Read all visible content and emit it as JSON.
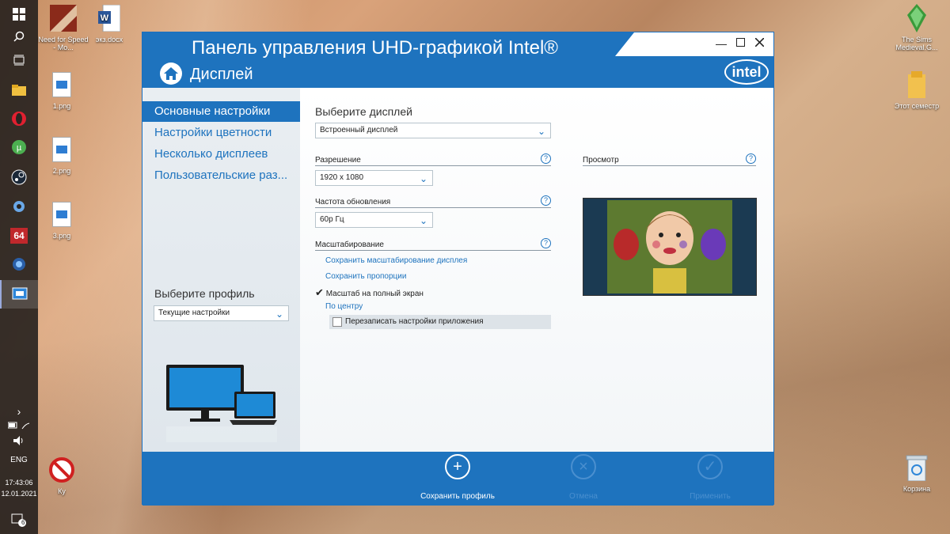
{
  "desktop": {
    "icons_left": [
      {
        "label": "Need for Speed - Mo...",
        "icon": "game-icon"
      },
      {
        "label": "экз.docx",
        "icon": "word-document-icon"
      },
      {
        "label": "1.png",
        "icon": "image-file-icon"
      },
      {
        "label": "2.png",
        "icon": "image-file-icon"
      },
      {
        "label": "3.png",
        "icon": "image-file-icon"
      },
      {
        "label": "Ку",
        "icon": "no-entry-icon"
      }
    ],
    "icons_right": [
      {
        "label": "The Sims Medieval.G...",
        "icon": "game-icon"
      },
      {
        "label": "Этот семестр",
        "icon": "folder-icon"
      },
      {
        "label": "Корзина",
        "icon": "recycle-bin-icon"
      }
    ]
  },
  "taskbar": {
    "language": "ENG",
    "time": "17:43:06",
    "date": "12.01.2021",
    "notification_count": "6",
    "app_badge": "64"
  },
  "window": {
    "title": "Панель управления UHD-графикой Intel®",
    "section": "Дисплей",
    "brand_logo": "intel",
    "sidebar": {
      "items": [
        {
          "label": "Основные настройки",
          "active": true
        },
        {
          "label": "Настройки цветности",
          "active": false
        },
        {
          "label": "Несколько дисплеев",
          "active": false
        },
        {
          "label": "Пользовательские раз...",
          "active": false
        }
      ],
      "profile_label": "Выберите профиль",
      "profile_value": "Текущие настройки"
    },
    "main": {
      "select_display_label": "Выберите дисплей",
      "select_display_value": "Встроенный дисплей",
      "resolution_label": "Разрешение",
      "resolution_value": "1920 x 1080",
      "refresh_label": "Частота обновления",
      "refresh_value": "60р Гц",
      "scaling_label": "Масштабирование",
      "scaling_options": [
        {
          "label": "Сохранить масштабирование дисплея",
          "checked": false
        },
        {
          "label": "Сохранить пропорции",
          "checked": false
        },
        {
          "label": "Масштаб на полный экран",
          "checked": true
        },
        {
          "label": "По центру",
          "checked": false
        }
      ],
      "override_label": "Перезаписать настройки приложения",
      "preview_label": "Просмотр",
      "help_glyph": "?"
    },
    "footer": {
      "save_profile": "Сохранить профиль",
      "cancel": "Отмена",
      "apply": "Применить"
    }
  },
  "colors": {
    "accent": "#1e73be",
    "taskbar": "#2a2522"
  }
}
